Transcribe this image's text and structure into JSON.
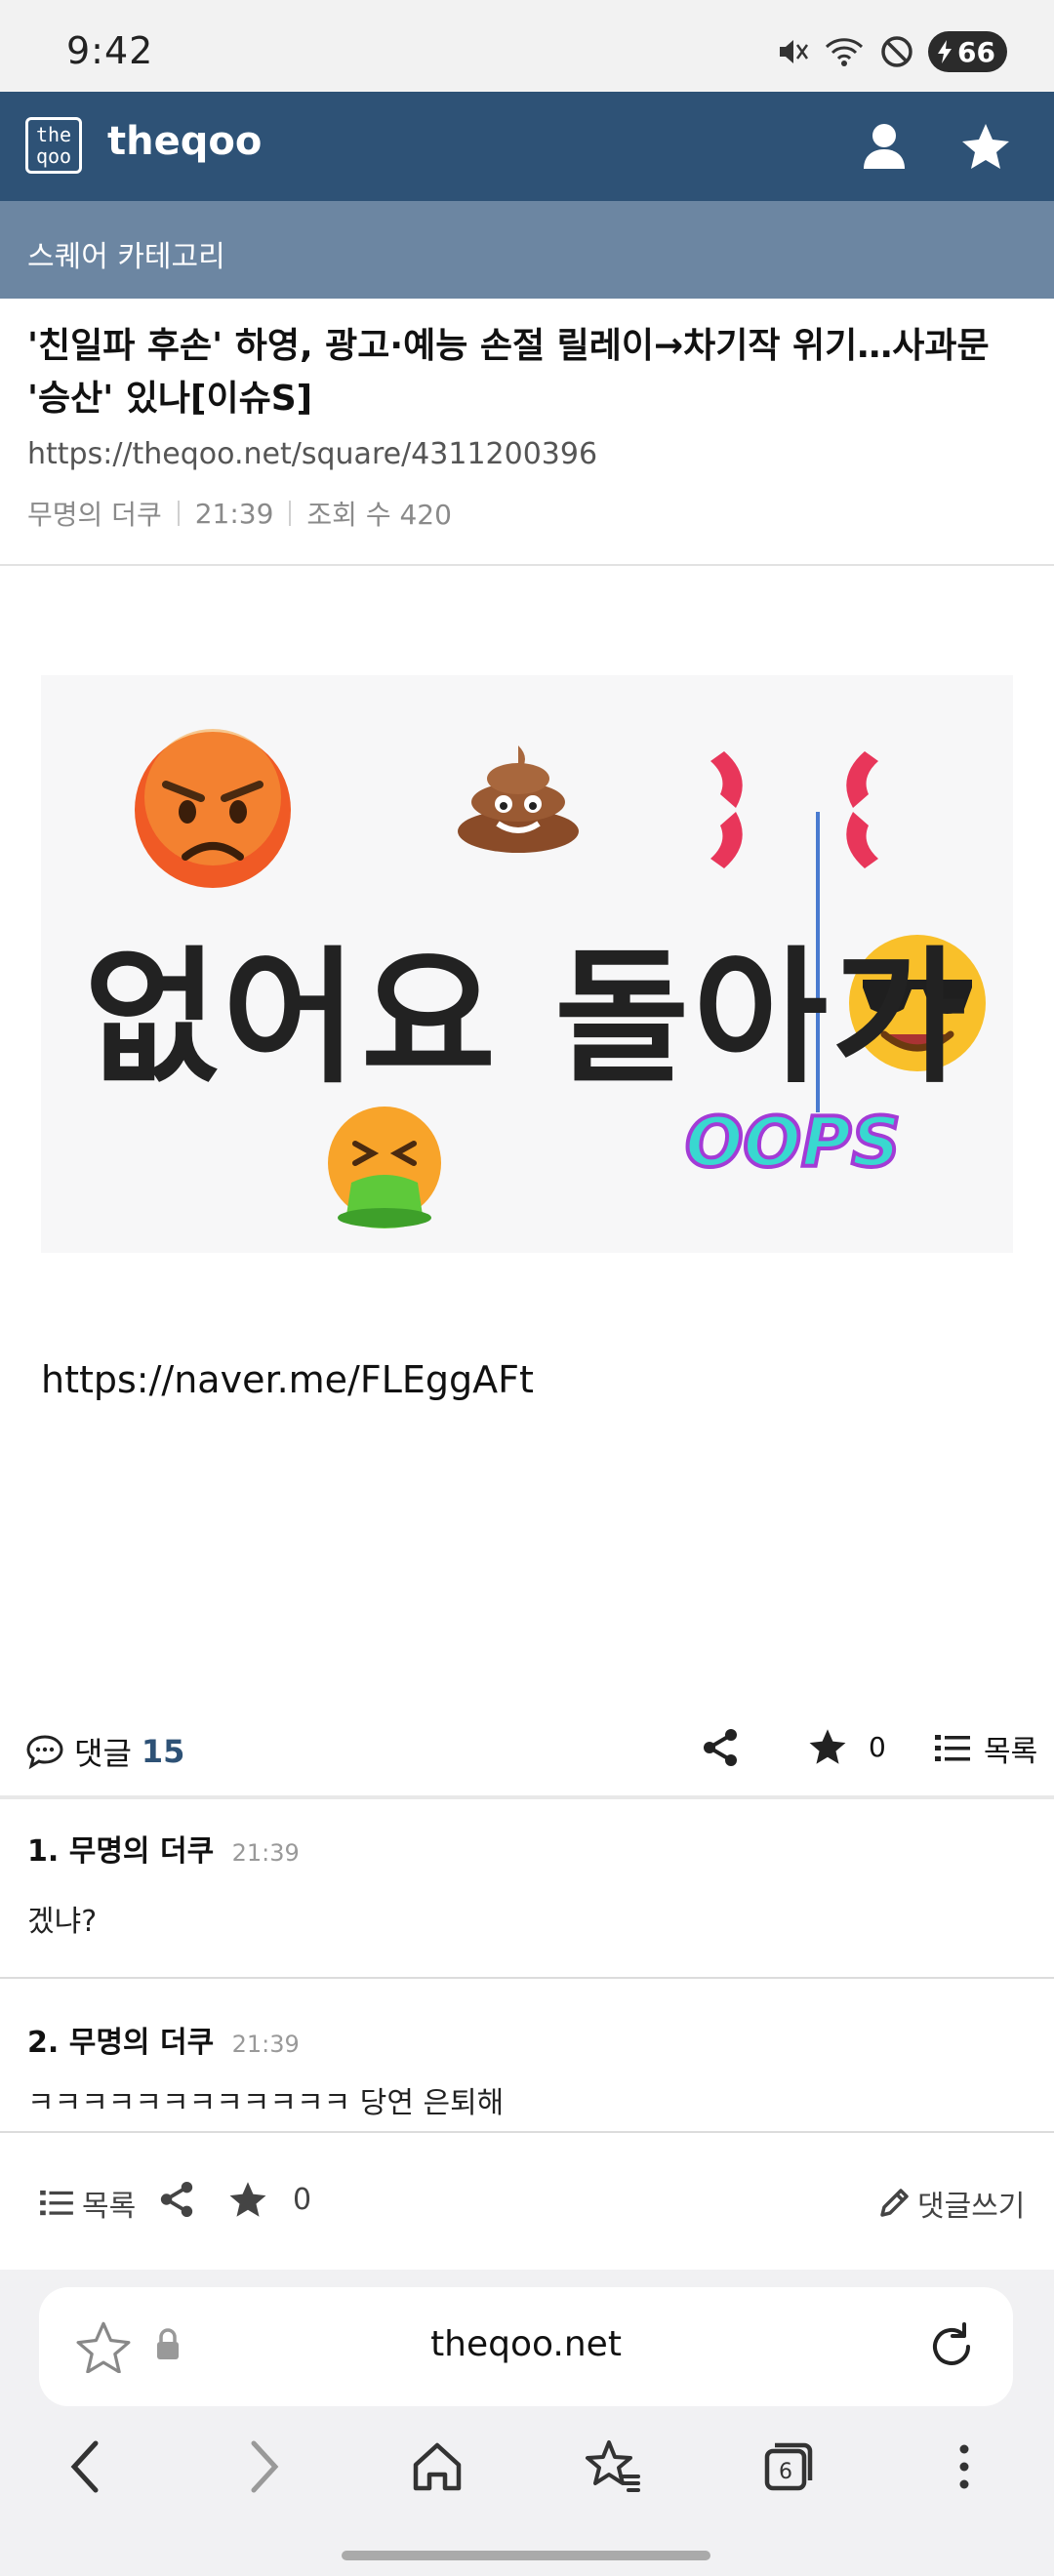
{
  "status_bar": {
    "time": "9:42",
    "battery": "66"
  },
  "header": {
    "logo_text": "theqoo",
    "title": "theqoo"
  },
  "category": {
    "label": "스퀘어 카테고리"
  },
  "article": {
    "title": "'친일파 후손' 하영, 광고·예능 손절 릴레이→차기작 위기…사과문 '승산' 있나[이슈S]",
    "url": "https://theqoo.net/square/4311200396",
    "author": "무명의 더쿠",
    "time": "21:39",
    "views": "조회 수 420",
    "image_text": "없어요 돌아가",
    "image_oops": "OOPS",
    "body_link": "https://naver.me/FLEggAFt"
  },
  "comment_bar": {
    "label": "댓글",
    "count": "15",
    "star_count": "0",
    "list_label": "목록"
  },
  "comments": [
    {
      "number": "1.",
      "author": "무명의 더쿠",
      "time": "21:39",
      "text": "겠냐?"
    },
    {
      "number": "2.",
      "author": "무명의 더쿠",
      "time": "21:39",
      "text": "ㅋㅋㅋㅋㅋㅋㅋㅋㅋㅋㅋㅋ 당연 은퇴해"
    }
  ],
  "actions": {
    "list_label": "목록",
    "star_count": "0",
    "write_label": "댓글쓰기"
  },
  "browser": {
    "url": "theqoo.net",
    "tab_count": "6"
  },
  "colors": {
    "header": "#2e5276",
    "category": "#6c86a2",
    "accent": "#2e5276"
  }
}
